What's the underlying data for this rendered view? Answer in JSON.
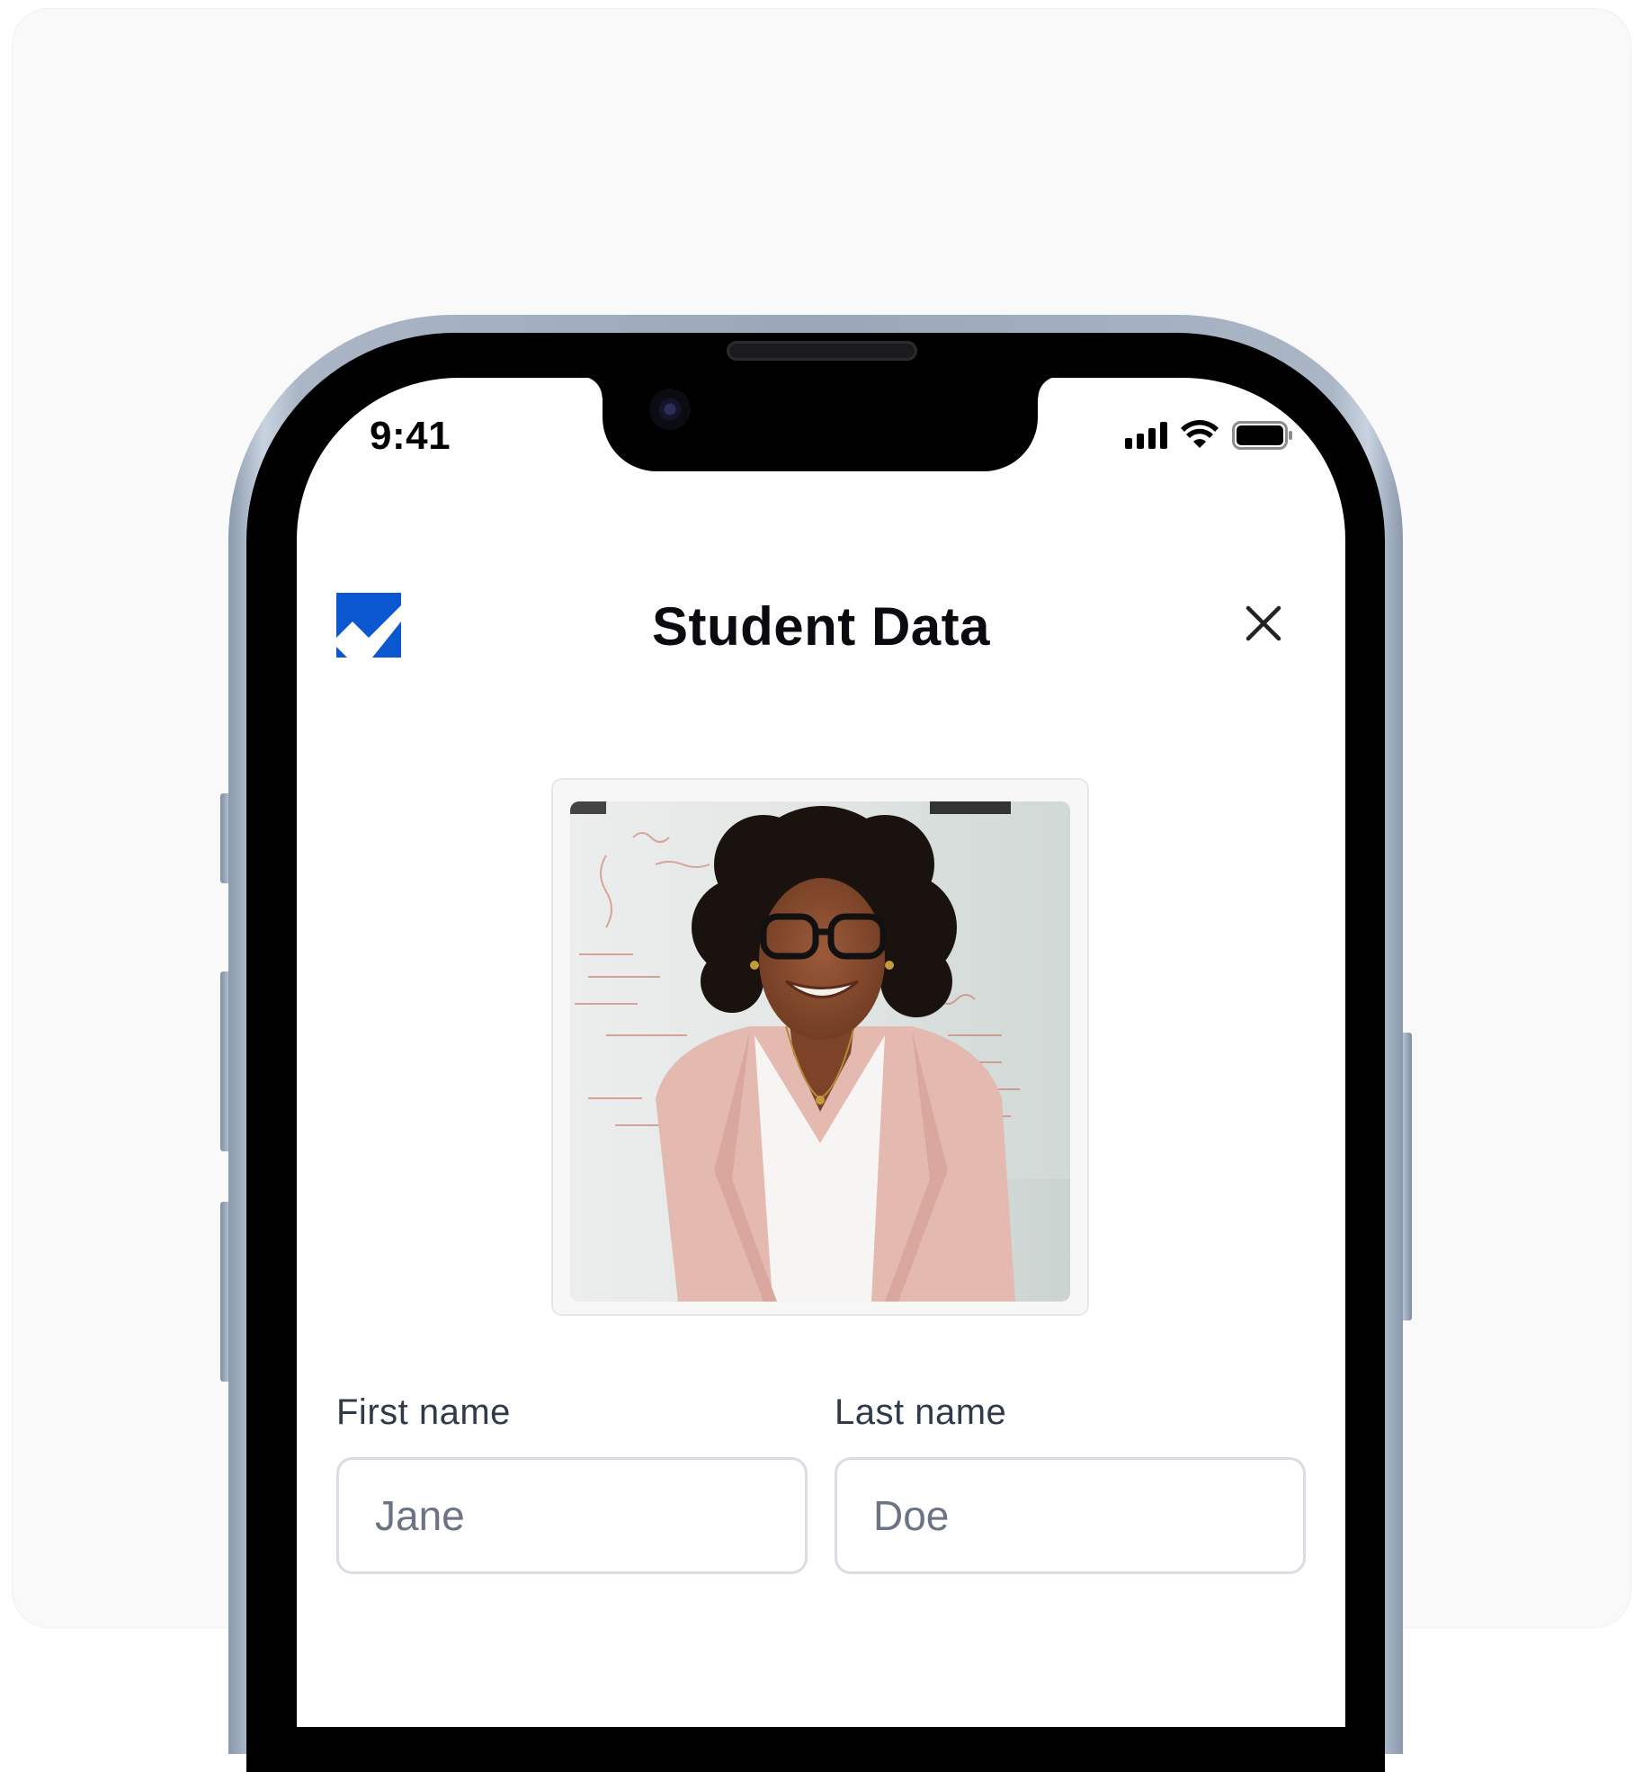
{
  "status_bar": {
    "time": "9:41",
    "icons": [
      "cellular-signal-icon",
      "wifi-icon",
      "battery-icon"
    ]
  },
  "header": {
    "logo": "checkmark-logo",
    "title": "Student Data",
    "close_icon": "close-icon"
  },
  "photo": {
    "subject": "smiling-person-portrait"
  },
  "form": {
    "first_name": {
      "label": "First name",
      "placeholder": "Jane",
      "value": ""
    },
    "last_name": {
      "label": "Last name",
      "placeholder": "Doe",
      "value": ""
    }
  },
  "colors": {
    "brand": "#0b57d0",
    "label_text": "#2f3a4b",
    "input_border": "#d9dce3",
    "placeholder_text": "#6b7385"
  }
}
